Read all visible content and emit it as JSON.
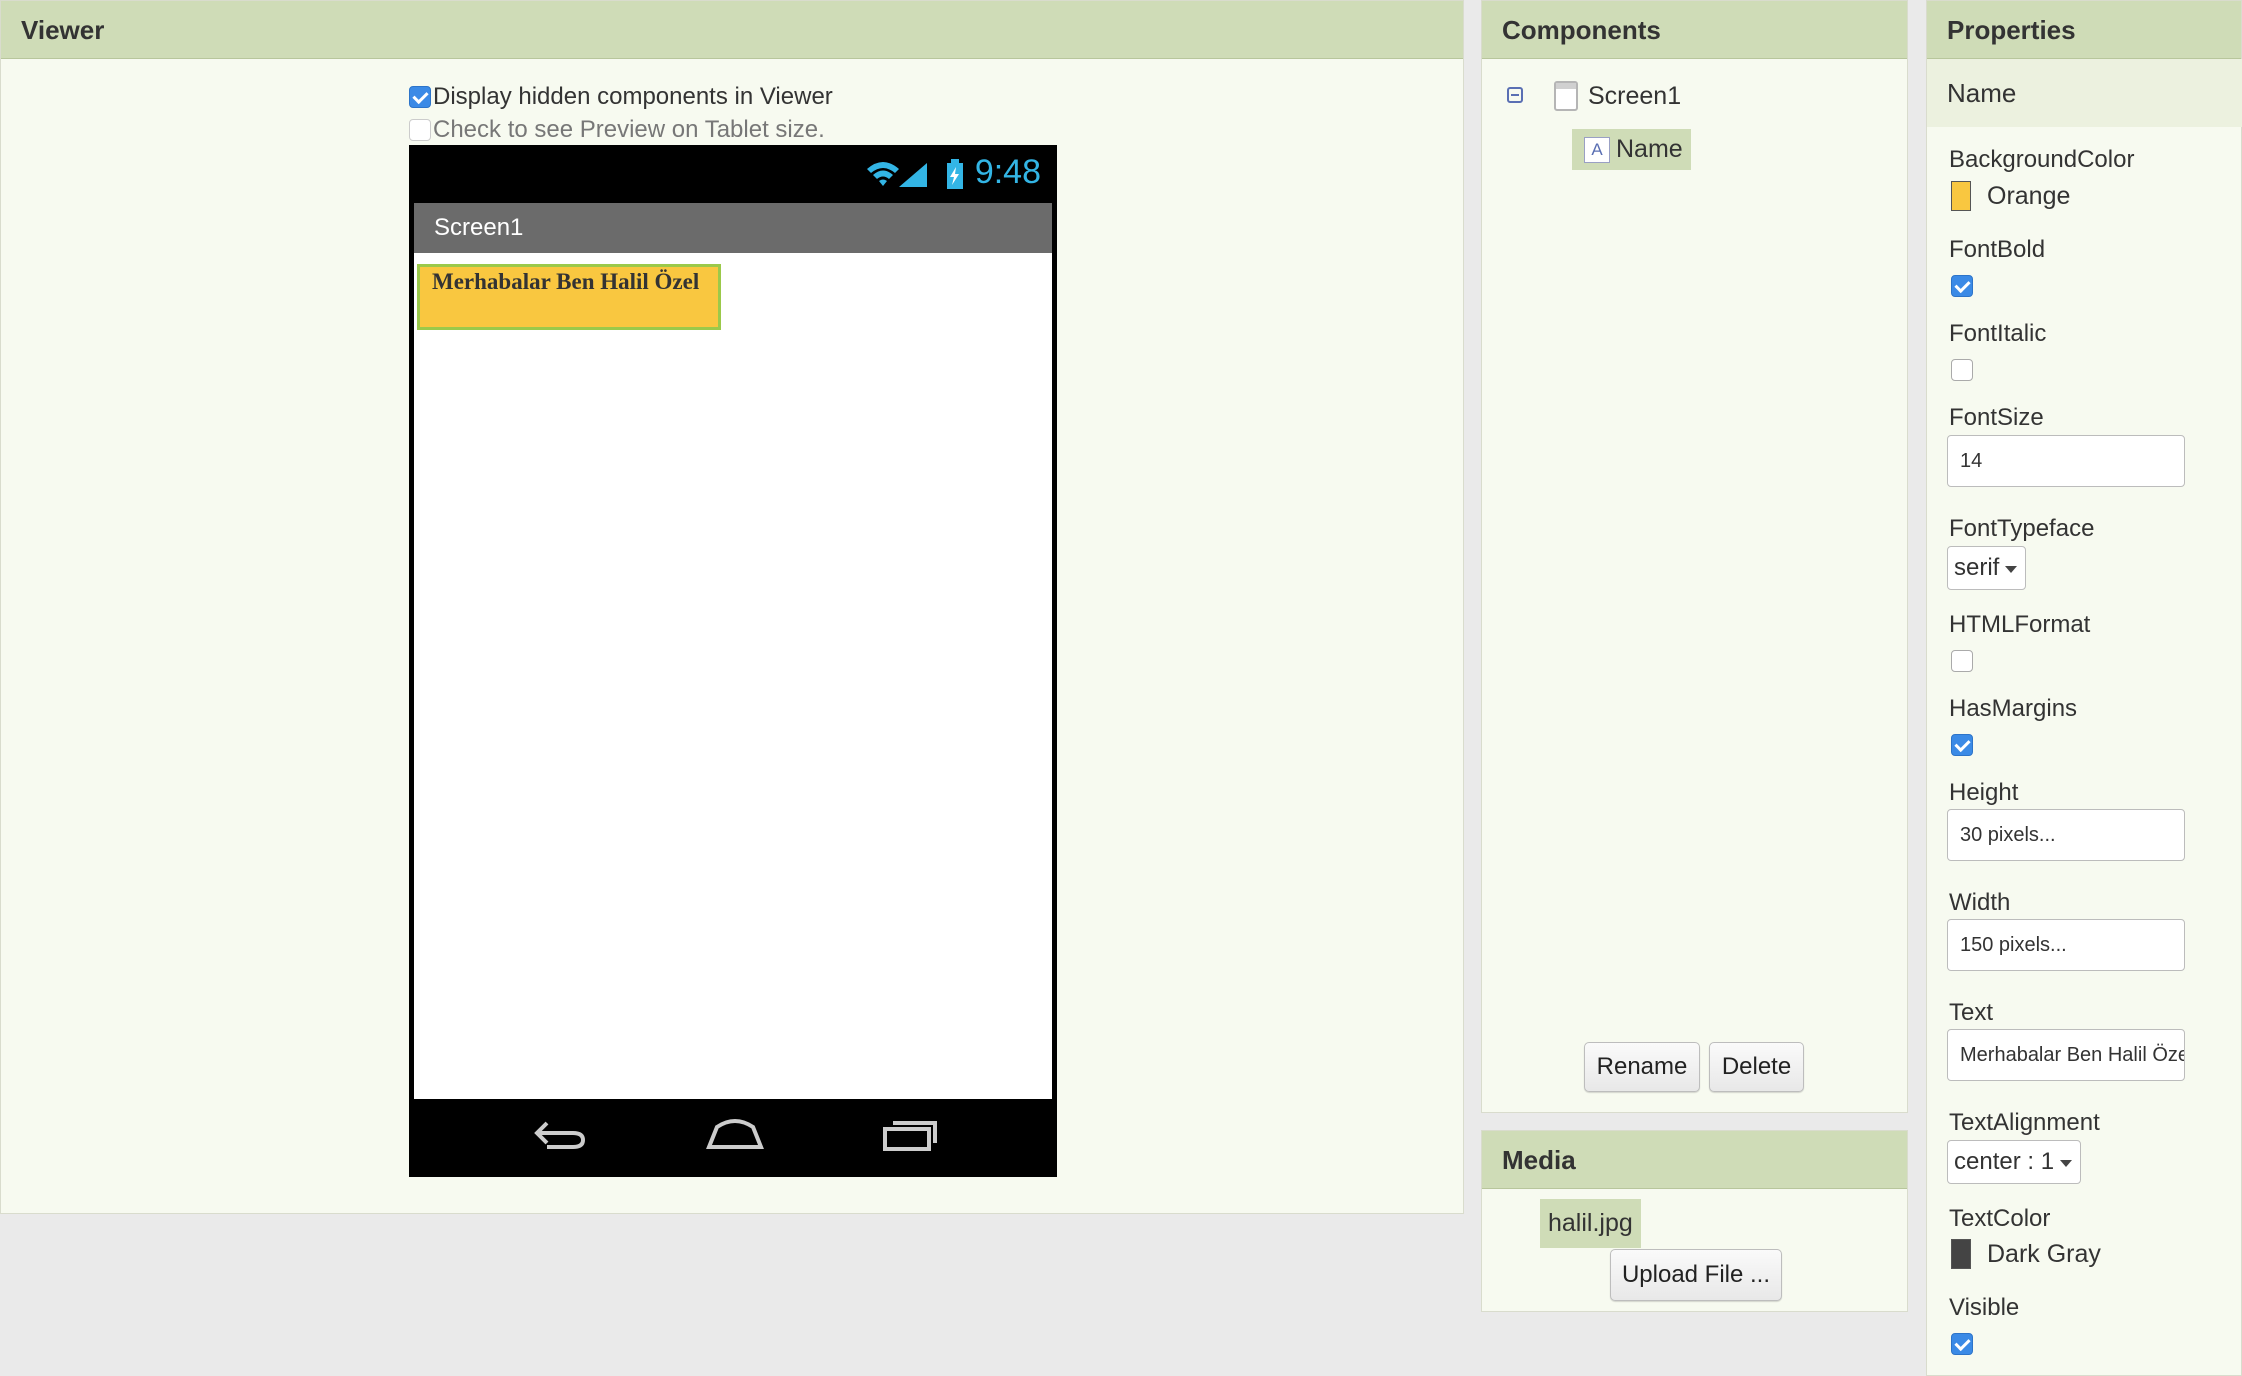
{
  "viewer": {
    "title": "Viewer",
    "display_hidden_label": "Display hidden components in Viewer",
    "display_hidden_checked": true,
    "tablet_preview_label": "Check to see Preview on Tablet size.",
    "tablet_preview_checked": false,
    "phone": {
      "clock": "9:48",
      "screen_title": "Screen1",
      "label_text": "Merhabalar Ben Halil Özel"
    }
  },
  "components": {
    "title": "Components",
    "tree": {
      "root": "Screen1",
      "children": [
        "Name"
      ]
    },
    "rename_label": "Rename",
    "delete_label": "Delete"
  },
  "media": {
    "title": "Media",
    "files": [
      "halil.jpg"
    ],
    "upload_label": "Upload File ..."
  },
  "properties": {
    "title": "Properties",
    "component_name": "Name",
    "background_color": {
      "label": "BackgroundColor",
      "value": "Orange",
      "swatch": "#f9c740"
    },
    "font_bold": {
      "label": "FontBold",
      "checked": true
    },
    "font_italic": {
      "label": "FontItalic",
      "checked": false
    },
    "font_size": {
      "label": "FontSize",
      "value": "14"
    },
    "font_typeface": {
      "label": "FontTypeface",
      "value": "serif"
    },
    "html_format": {
      "label": "HTMLFormat",
      "checked": false
    },
    "has_margins": {
      "label": "HasMargins",
      "checked": true
    },
    "height": {
      "label": "Height",
      "value": "30 pixels..."
    },
    "width": {
      "label": "Width",
      "value": "150 pixels..."
    },
    "text": {
      "label": "Text",
      "value": "Merhabalar Ben Halil Özel"
    },
    "text_alignment": {
      "label": "TextAlignment",
      "value": "center : 1"
    },
    "text_color": {
      "label": "TextColor",
      "value": "Dark Gray",
      "swatch": "#444444"
    },
    "visible": {
      "label": "Visible",
      "checked": true
    }
  }
}
